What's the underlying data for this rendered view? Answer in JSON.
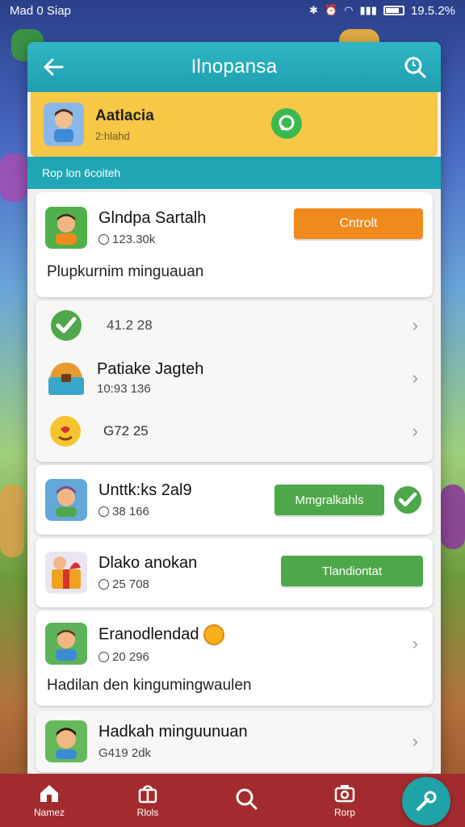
{
  "status": {
    "left": "Mad 0 Siap",
    "right": "19.5.2%"
  },
  "header": {
    "title": "Ilnopansa"
  },
  "banner": {
    "name": "Aatlacia",
    "sub": "2:hlahd"
  },
  "section": {
    "label": "Rop lon 6coiteh"
  },
  "card1": {
    "title": "Glndpa Sartalh",
    "sub": "123.30k",
    "button": "Cntrolt",
    "desc": "Plupkurnim minguauan"
  },
  "list": [
    {
      "value": "41.2 28"
    },
    {
      "title": "Patiake Jagteh",
      "sub": "10:93 136"
    },
    {
      "value": "G72 25"
    }
  ],
  "card3": {
    "title": "Unttk:ks 2al9",
    "sub": "38 166",
    "button": "Mmgralkahls"
  },
  "card4": {
    "title": "Dlako anokan",
    "sub": "25 708",
    "button": "Tlandiontat"
  },
  "card5": {
    "title": "Eranodlendad",
    "sub": "20 296",
    "desc": "Hadilan den kingumingwaulen"
  },
  "card6": {
    "title": "Hadkah minguunuan",
    "sub": "G419 2dk"
  },
  "nav": [
    {
      "label": "Namez"
    },
    {
      "label": "Rlols"
    },
    {
      "label": ""
    },
    {
      "label": "Rorp"
    }
  ],
  "colors": {
    "teal": "#21a6b6",
    "yellow": "#f7c746",
    "orange": "#f08a1c",
    "green": "#4ea84a",
    "navbar": "#a42b2d"
  }
}
